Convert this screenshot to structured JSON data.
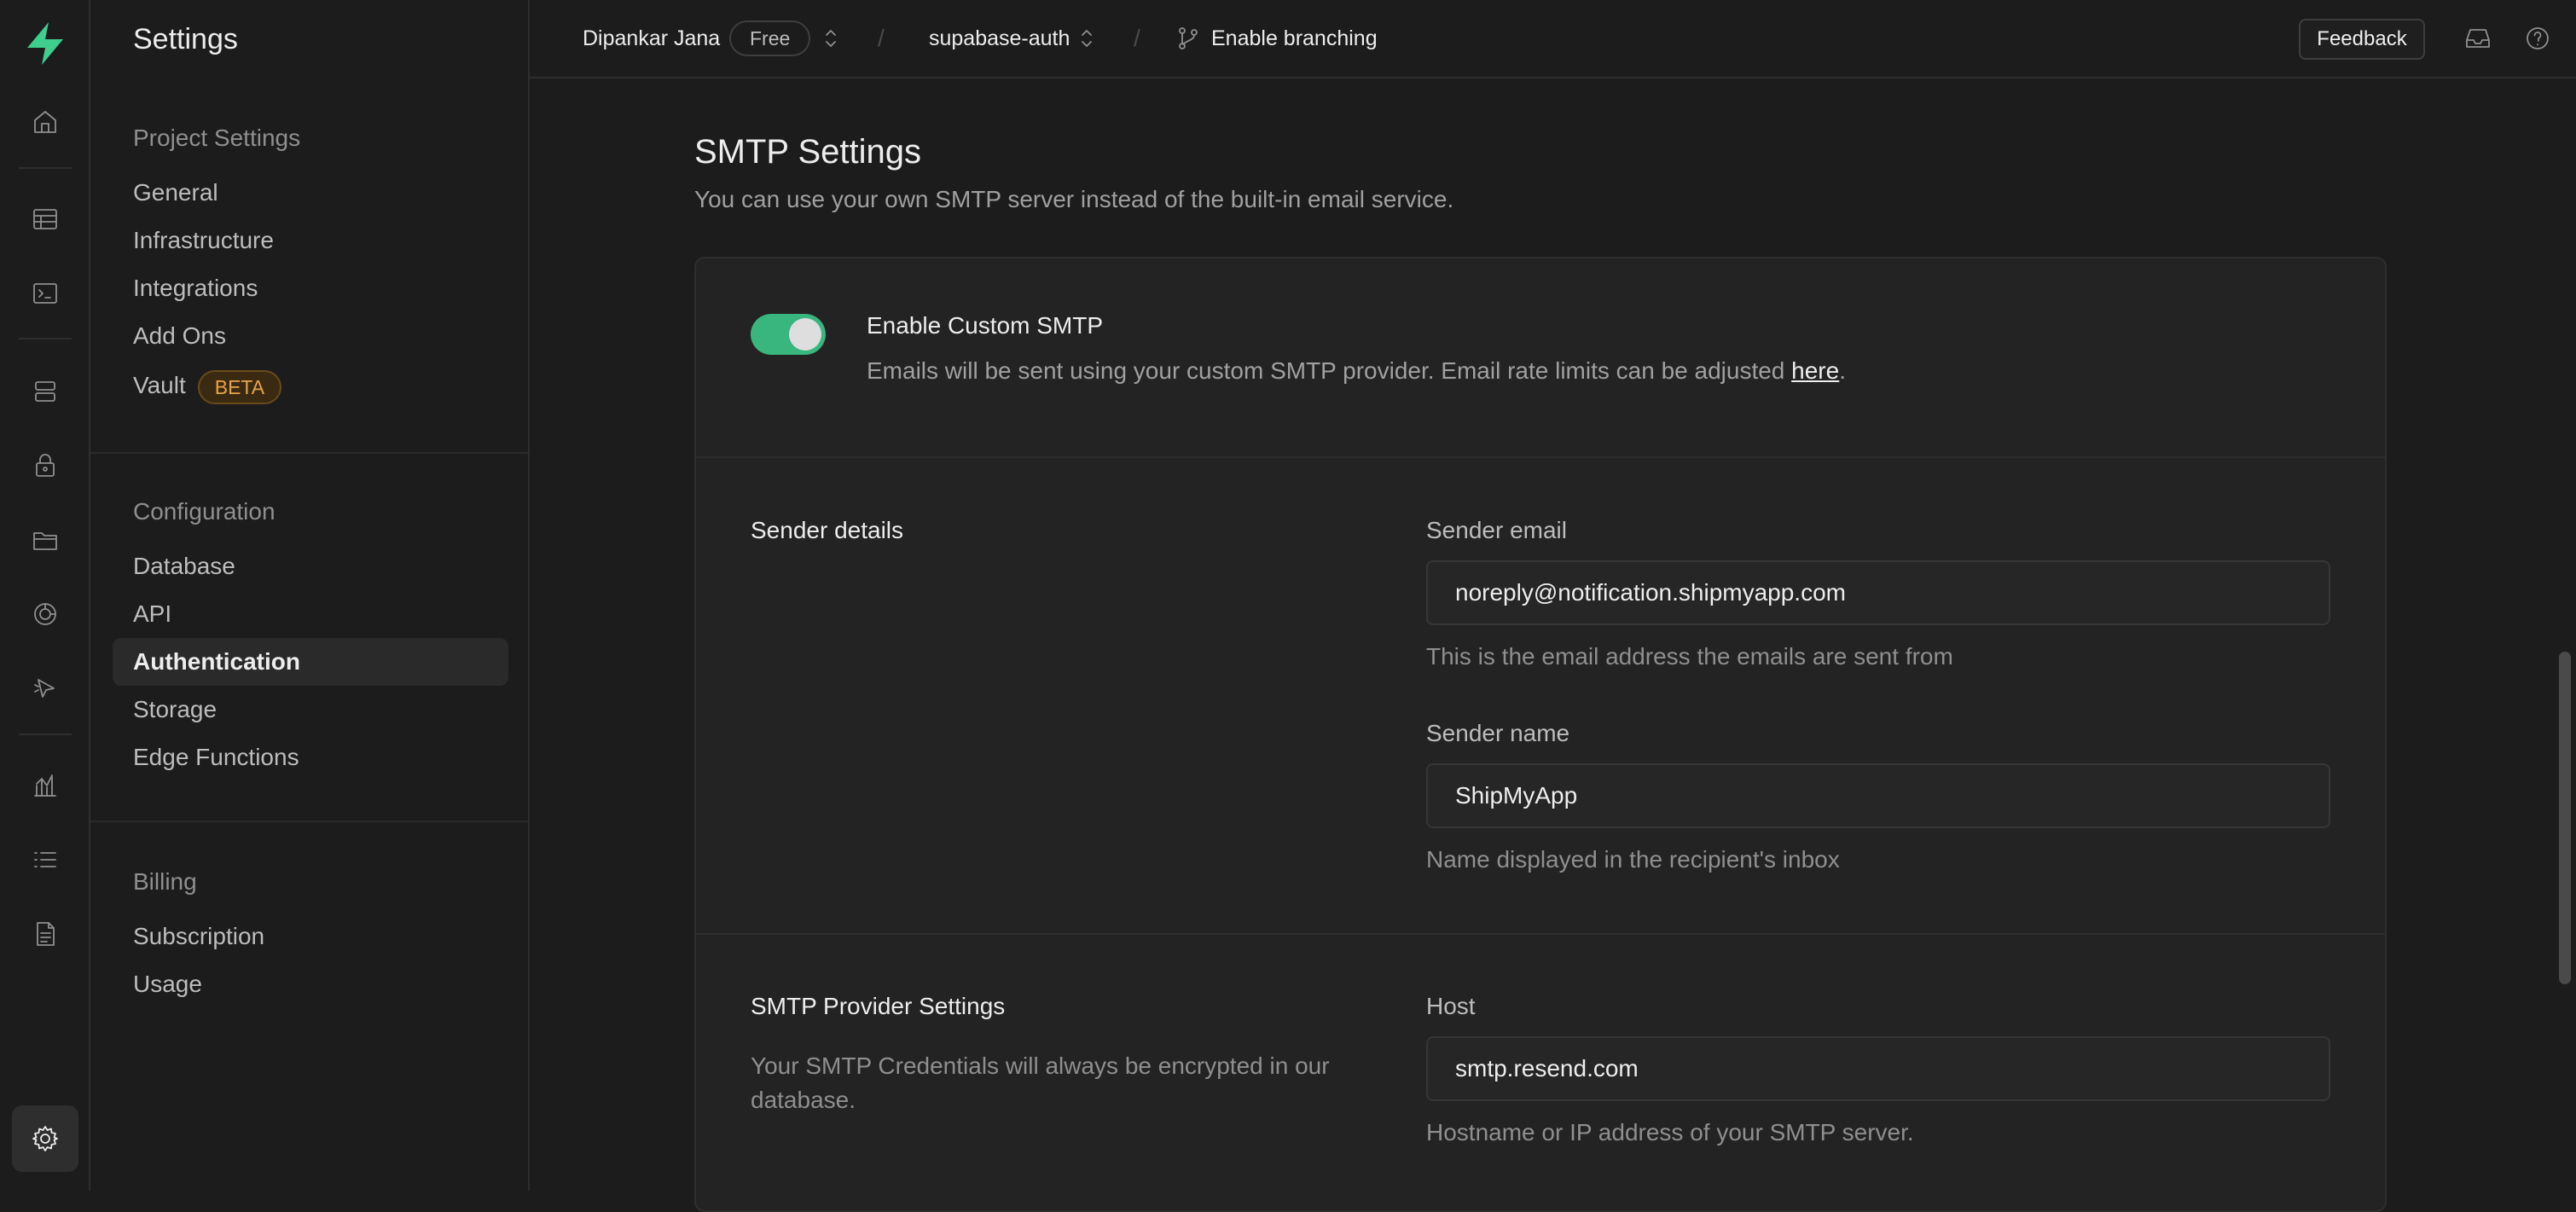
{
  "app": {
    "accent_color": "#3ecf8e",
    "logo_icon": "supabase-logo-icon"
  },
  "rail": {
    "items": [
      {
        "icon": "home-icon"
      },
      {
        "icon": "table-editor-icon"
      },
      {
        "icon": "sql-editor-icon"
      },
      {
        "icon": "database-icon"
      },
      {
        "icon": "auth-lock-icon"
      },
      {
        "icon": "storage-folder-icon"
      },
      {
        "icon": "realtime-icon"
      },
      {
        "icon": "edge-functions-icon"
      },
      {
        "icon": "reports-chart-icon"
      },
      {
        "icon": "logs-list-icon"
      },
      {
        "icon": "api-docs-icon"
      },
      {
        "icon": "settings-gear-icon"
      }
    ]
  },
  "menu": {
    "title": "Settings",
    "project_settings": {
      "heading": "Project Settings",
      "items": [
        "General",
        "Infrastructure",
        "Integrations",
        "Add Ons",
        "Vault"
      ],
      "vault_badge": "BETA"
    },
    "configuration": {
      "heading": "Configuration",
      "items": [
        "Database",
        "API",
        "Authentication",
        "Storage",
        "Edge Functions"
      ],
      "active": "Authentication"
    },
    "billing": {
      "heading": "Billing",
      "items": [
        "Subscription",
        "Usage"
      ]
    }
  },
  "topbar": {
    "org_name": "Dipankar Jana",
    "plan_badge": "Free",
    "project_name": "supabase-auth",
    "branching_label": "Enable branching",
    "separator": "/",
    "feedback_label": "Feedback"
  },
  "smtp": {
    "title": "SMTP Settings",
    "description": "You can use your own SMTP server instead of the built-in email service.",
    "toggle": {
      "enabled": true,
      "label": "Enable Custom SMTP",
      "description": "Emails will be sent using your custom SMTP provider. Email rate limits can be adjusted ",
      "link_text": "here",
      "trailing": "."
    },
    "sender_details": {
      "title": "Sender details",
      "email_label": "Sender email",
      "email_value": "noreply@notification.shipmyapp.com",
      "email_help": "This is the email address the emails are sent from",
      "name_label": "Sender name",
      "name_value": "ShipMyApp",
      "name_help": "Name displayed in the recipient's inbox"
    },
    "provider": {
      "title": "SMTP Provider Settings",
      "description": "Your SMTP Credentials will always be encrypted in our database.",
      "host_label": "Host",
      "host_value": "smtp.resend.com",
      "host_help": "Hostname or IP address of your SMTP server."
    }
  }
}
